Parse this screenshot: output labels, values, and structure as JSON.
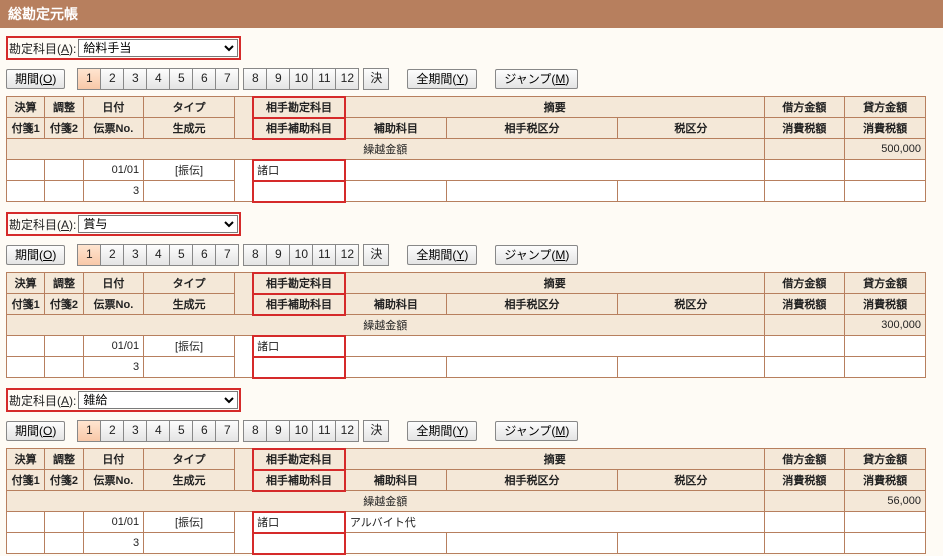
{
  "title": "総勘定元帳",
  "labels": {
    "account": "勘定科目(A):",
    "period": "期間(O)",
    "kessan": "決",
    "fullPeriod": "全期間(Y)",
    "jump": "ジャンプ(M)"
  },
  "months": [
    "1",
    "2",
    "3",
    "4",
    "5",
    "6",
    "7",
    "8",
    "9",
    "10",
    "11",
    "12"
  ],
  "headers": {
    "kessan": "決算",
    "chousei": "調整",
    "date": "日付",
    "type": "タイプ",
    "counterAccount": "相手勘定科目",
    "summary": "摘要",
    "debit": "借方金額",
    "credit": "貸方金額",
    "fusen1": "付箋1",
    "fusen2": "付箋2",
    "denpyoNo": "伝票No.",
    "seiseimoto": "生成元",
    "counterAux": "相手補助科目",
    "aux": "補助科目",
    "counterTax": "相手税区分",
    "tax": "税区分",
    "consTaxDebit": "消費税額",
    "consTaxCredit": "消費税額",
    "carryOver": "繰越金額"
  },
  "sections": [
    {
      "account": "給料手当",
      "carryOver": "500,000",
      "row": {
        "date": "01/01",
        "denpyo": "3",
        "type": "[振伝]",
        "counter": "諸口",
        "summary": ""
      }
    },
    {
      "account": "賞与",
      "carryOver": "300,000",
      "row": {
        "date": "01/01",
        "denpyo": "3",
        "type": "[振伝]",
        "counter": "諸口",
        "summary": ""
      }
    },
    {
      "account": "雑給",
      "carryOver": "56,000",
      "row": {
        "date": "01/01",
        "denpyo": "3",
        "type": "[振伝]",
        "counter": "諸口",
        "summary": "アルバイト代"
      }
    }
  ]
}
